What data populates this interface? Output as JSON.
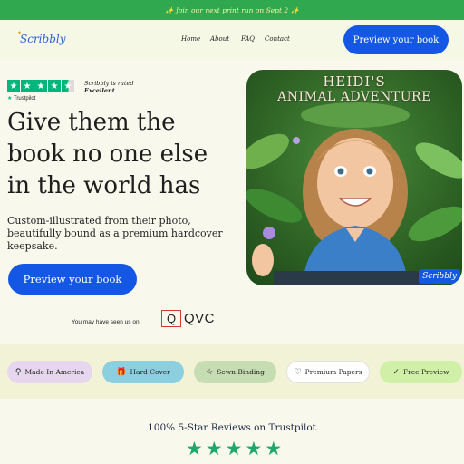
{
  "banner": {
    "text": "✨ Join our next print run on Sept 2 ✨"
  },
  "header": {
    "logo": "Scribbly",
    "nav": [
      "Home",
      "About",
      "FAQ",
      "Contact"
    ],
    "cta": "Preview your book"
  },
  "trustpilot": {
    "brand": "Trustpilot",
    "rated_line1": "Scribbly is rated",
    "rated_line2": "Excellent",
    "star_glyph": "★"
  },
  "hero": {
    "headline": "Give them the book no one else in the world has",
    "subtitle": "Custom-illustrated from their photo, beautifully bound as a premium hardcover keepsake.",
    "cta": "Preview your book",
    "book_title_line1": "HEIDI'S",
    "book_title_line2": "ANIMAL ADVENTURE",
    "book_logo": "Scribbly"
  },
  "seen_on": {
    "label": "You may have seen us on",
    "brand_mark": "Q",
    "brand_name": "QVC"
  },
  "features": [
    {
      "label": "Made In America",
      "icon": "map-pin-icon",
      "glyph": "⚲",
      "color": "#e6d7ef"
    },
    {
      "label": "Hard Cover",
      "icon": "gift-icon",
      "glyph": "🎁",
      "color": "#8ccfdf"
    },
    {
      "label": "Sewn Binding",
      "icon": "star-outline-icon",
      "glyph": "☆",
      "color": "#c6dcb2"
    },
    {
      "label": "Premium Papers",
      "icon": "heart-outline-icon",
      "glyph": "♡",
      "color": "#ffffff"
    },
    {
      "label": "Free Preview",
      "icon": "check-icon",
      "glyph": "✓",
      "color": "#cff0a6"
    }
  ],
  "reviews": {
    "heading": "100% 5-Star Reviews on Trustpilot",
    "star_glyph": "★"
  },
  "colors": {
    "accent": "#1557e5",
    "banner": "#2fa84f",
    "trustpilot_green": "#00b67a"
  }
}
